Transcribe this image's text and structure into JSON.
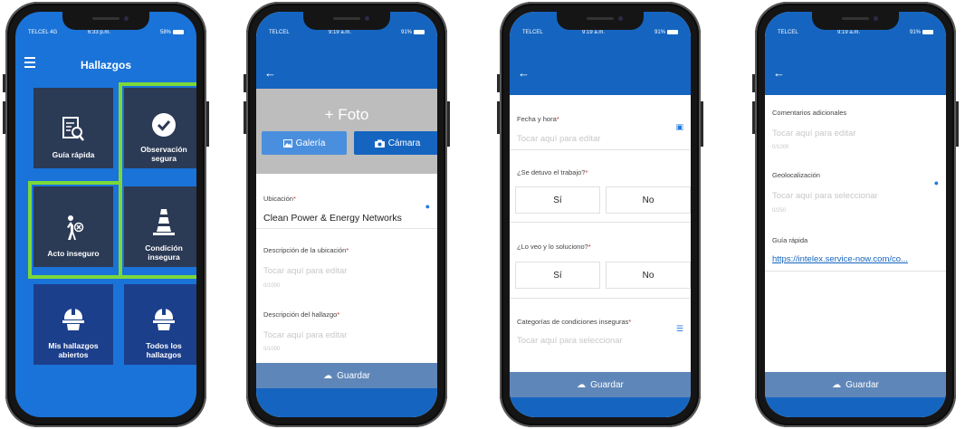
{
  "screen1": {
    "status": {
      "carrier": "TELCEL 4G",
      "time": "6:33 p.m.",
      "battery": "58%"
    },
    "title": "Hallazgos",
    "tiles": [
      {
        "label": "Guía rápida",
        "icon": "guide-icon"
      },
      {
        "label": "Observación segura",
        "icon": "check-circle-icon"
      },
      {
        "label": "Acto inseguro",
        "icon": "unsafe-person-icon"
      },
      {
        "label": "Condición insegura",
        "icon": "traffic-cone-icon"
      },
      {
        "label": "Mis hallazgos abiertos",
        "icon": "hard-hat-icon"
      },
      {
        "label": "Todos los hallazgos",
        "icon": "hard-hat-icon"
      }
    ],
    "highlight_color": "#7cd83a"
  },
  "screen2": {
    "status": {
      "carrier": "TELCEL",
      "time": "9:19 a.m.",
      "battery": "91%"
    },
    "foto": "+ Foto",
    "gallery_button": "Galería",
    "camera_button": "Cámara",
    "location_label": "Ubicación",
    "location_value": "Clean Power & Energy Networks",
    "location_desc_label": "Descripción de la ubicación",
    "location_desc_placeholder": "Tocar aquí para editar",
    "location_desc_counter": "0/1000",
    "finding_desc_label": "Descripción del hallazgo",
    "finding_desc_placeholder": "Tocar aquí para editar",
    "finding_desc_counter": "0/1000",
    "save_button": "Guardar"
  },
  "screen3": {
    "status": {
      "carrier": "TELCEL",
      "time": "9:19 a.m.",
      "battery": "91%"
    },
    "datetime_label": "Fecha y hora",
    "datetime_placeholder": "Tocar aquí para editar",
    "stopped_label": "¿Se detuvo el trabajo?",
    "stopped_yes": "Sí",
    "stopped_no": "No",
    "saw_label": "¿Lo veo y lo soluciono?",
    "saw_yes": "Sí",
    "saw_no": "No",
    "categories_label": "Categorías de condiciones inseguras",
    "categories_placeholder": "Tocar aquí para seleccionar",
    "save_button": "Guardar"
  },
  "screen4": {
    "status": {
      "carrier": "TELCEL",
      "time": "9:19 a.m.",
      "battery": "91%"
    },
    "comments_label": "Comentarios adicionales",
    "comments_placeholder": "Tocar aquí para editar",
    "comments_counter": "0/1000",
    "geo_label": "Geolocalización",
    "geo_placeholder": "Tocar aquí para seleccionar",
    "geo_counter": "0/250",
    "guide_label": "Guía rápida",
    "guide_link": "https://intelex.service-now.com/co...",
    "save_button": "Guardar"
  },
  "colors": {
    "primary": "#1565c0",
    "tile": "#2b3a55",
    "save_bar": "#5f86b8",
    "required": "#d32f2f"
  }
}
